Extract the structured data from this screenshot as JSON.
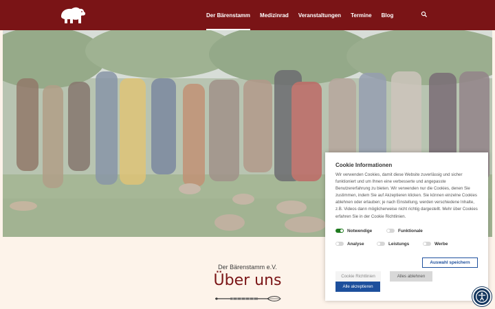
{
  "brand": {
    "logo_icon": "polar-bear-icon"
  },
  "nav": {
    "items": [
      {
        "label": "Der Bärenstamm",
        "active": true
      },
      {
        "label": "Medizinrad",
        "active": false
      },
      {
        "label": "Veranstaltungen",
        "active": false
      },
      {
        "label": "Termine",
        "active": false
      },
      {
        "label": "Blog",
        "active": false
      }
    ],
    "search_icon": "search-icon"
  },
  "hero": {
    "slide_count": 6,
    "active_slide": 0
  },
  "about": {
    "kicker": "Der Bärenstamm e.V.",
    "title": "Über uns"
  },
  "cookie": {
    "title": "Cookie Informationen",
    "text": "Wir verwenden Cookies, damit diese Website zuverlässig und sicher funktioniert und um Ihnen eine verbesserte und angepasste Benutzererfahrung zu bieten. Wir verwenden nur die Cookies, denen Sie zustimmen, indem Sie auf Akzeptieren klicken. Sie können einzelne Cookies ablehnen oder erlauben; je nach Einstellung, werden verschiedene Inhalte, z.B. Videos dann möglicherweise nicht richtig dargestellt. Mehr über Cookies erfahren Sie in der Cookie Richtlinien.",
    "toggles": [
      {
        "label": "Notwendige",
        "on": true
      },
      {
        "label": "Funktionale",
        "on": false
      },
      {
        "label": "Analyse",
        "on": false
      },
      {
        "label": "Leistungs",
        "on": false
      },
      {
        "label": "Werbe",
        "on": false
      }
    ],
    "save_label": "Auswahl speichern",
    "policy_label": "Cookie Richtlinien",
    "reject_label": "Alles ablehnen",
    "accept_label": "Alle akzeptieren"
  },
  "colors": {
    "header": "#7a1416",
    "accent_blue": "#1d4f9c",
    "toggle_on": "#1f7a1f",
    "page_bg": "#fdf3ea"
  },
  "accessibility_icon": "accessibility-icon"
}
